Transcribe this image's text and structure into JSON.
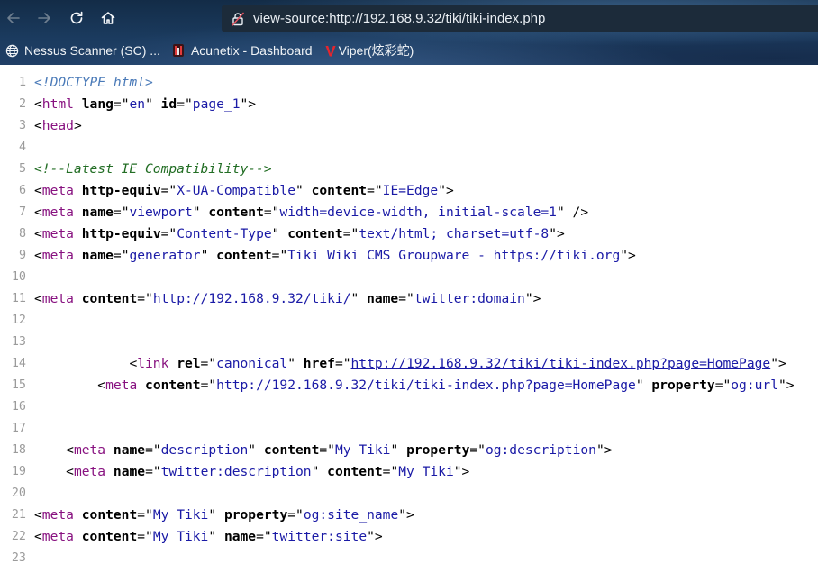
{
  "browser": {
    "nav": {
      "back_icon": "arrow-left-icon",
      "forward_icon": "arrow-right-icon",
      "reload_icon": "reload-icon",
      "home_icon": "home-icon"
    },
    "url": "view-source:http://192.168.9.32/tiki/tiki-index.php",
    "url_icon": "not-secure-icon",
    "bookmarks": [
      {
        "label": "Nessus Scanner (SC) ...",
        "icon": "globe-icon"
      },
      {
        "label": "Acunetix - Dashboard",
        "icon": "acunetix-icon"
      },
      {
        "label": "Viper(炫彩蛇)",
        "icon": "viper-v-icon"
      }
    ],
    "colors": {
      "chrome_bg": "#17324f",
      "tag": "#881280",
      "attr_value": "#1a1aa6",
      "comment": "#236e25",
      "line_number": "#9b9b9b"
    }
  },
  "source": {
    "lines": [
      {
        "n": "1",
        "indent": "",
        "parts": [
          {
            "t": "<!DOCTYPE html>",
            "k": "doc"
          }
        ]
      },
      {
        "n": "2",
        "indent": "",
        "parts": [
          {
            "t": "<",
            "k": "punc"
          },
          {
            "t": "html",
            "k": "tag"
          },
          {
            "t": " ",
            "k": "punc"
          },
          {
            "t": "lang",
            "k": "attr"
          },
          {
            "t": "=\"",
            "k": "punc"
          },
          {
            "t": "en",
            "k": "val"
          },
          {
            "t": "\" ",
            "k": "punc"
          },
          {
            "t": "id",
            "k": "attr"
          },
          {
            "t": "=\"",
            "k": "punc"
          },
          {
            "t": "page_1",
            "k": "val"
          },
          {
            "t": "\">",
            "k": "punc"
          }
        ]
      },
      {
        "n": "3",
        "indent": "",
        "parts": [
          {
            "t": "<",
            "k": "punc"
          },
          {
            "t": "head",
            "k": "tag"
          },
          {
            "t": ">",
            "k": "punc"
          }
        ]
      },
      {
        "n": "4",
        "indent": "",
        "parts": []
      },
      {
        "n": "5",
        "indent": "",
        "parts": [
          {
            "t": "<!--Latest IE Compatibility-->",
            "k": "com"
          }
        ]
      },
      {
        "n": "6",
        "indent": "",
        "parts": [
          {
            "t": "<",
            "k": "punc"
          },
          {
            "t": "meta",
            "k": "tag"
          },
          {
            "t": " ",
            "k": "punc"
          },
          {
            "t": "http-equiv",
            "k": "attr"
          },
          {
            "t": "=\"",
            "k": "punc"
          },
          {
            "t": "X-UA-Compatible",
            "k": "val"
          },
          {
            "t": "\" ",
            "k": "punc"
          },
          {
            "t": "content",
            "k": "attr"
          },
          {
            "t": "=\"",
            "k": "punc"
          },
          {
            "t": "IE=Edge",
            "k": "val"
          },
          {
            "t": "\">",
            "k": "punc"
          }
        ]
      },
      {
        "n": "7",
        "indent": "",
        "parts": [
          {
            "t": "<",
            "k": "punc"
          },
          {
            "t": "meta",
            "k": "tag"
          },
          {
            "t": " ",
            "k": "punc"
          },
          {
            "t": "name",
            "k": "attr"
          },
          {
            "t": "=\"",
            "k": "punc"
          },
          {
            "t": "viewport",
            "k": "val"
          },
          {
            "t": "\" ",
            "k": "punc"
          },
          {
            "t": "content",
            "k": "attr"
          },
          {
            "t": "=\"",
            "k": "punc"
          },
          {
            "t": "width=device-width, initial-scale=1",
            "k": "val"
          },
          {
            "t": "\" />",
            "k": "punc"
          }
        ]
      },
      {
        "n": "8",
        "indent": "",
        "parts": [
          {
            "t": "<",
            "k": "punc"
          },
          {
            "t": "meta",
            "k": "tag"
          },
          {
            "t": " ",
            "k": "punc"
          },
          {
            "t": "http-equiv",
            "k": "attr"
          },
          {
            "t": "=\"",
            "k": "punc"
          },
          {
            "t": "Content-Type",
            "k": "val"
          },
          {
            "t": "\" ",
            "k": "punc"
          },
          {
            "t": "content",
            "k": "attr"
          },
          {
            "t": "=\"",
            "k": "punc"
          },
          {
            "t": "text/html; charset=utf-8",
            "k": "val"
          },
          {
            "t": "\">",
            "k": "punc"
          }
        ]
      },
      {
        "n": "9",
        "indent": "",
        "parts": [
          {
            "t": "<",
            "k": "punc"
          },
          {
            "t": "meta",
            "k": "tag"
          },
          {
            "t": " ",
            "k": "punc"
          },
          {
            "t": "name",
            "k": "attr"
          },
          {
            "t": "=\"",
            "k": "punc"
          },
          {
            "t": "generator",
            "k": "val"
          },
          {
            "t": "\" ",
            "k": "punc"
          },
          {
            "t": "content",
            "k": "attr"
          },
          {
            "t": "=\"",
            "k": "punc"
          },
          {
            "t": "Tiki Wiki CMS Groupware - https://tiki.org",
            "k": "val"
          },
          {
            "t": "\">",
            "k": "punc"
          }
        ]
      },
      {
        "n": "10",
        "indent": "",
        "parts": []
      },
      {
        "n": "11",
        "indent": "",
        "parts": [
          {
            "t": "<",
            "k": "punc"
          },
          {
            "t": "meta",
            "k": "tag"
          },
          {
            "t": " ",
            "k": "punc"
          },
          {
            "t": "content",
            "k": "attr"
          },
          {
            "t": "=\"",
            "k": "punc"
          },
          {
            "t": "http://192.168.9.32/tiki/",
            "k": "val"
          },
          {
            "t": "\" ",
            "k": "punc"
          },
          {
            "t": "name",
            "k": "attr"
          },
          {
            "t": "=\"",
            "k": "punc"
          },
          {
            "t": "twitter:domain",
            "k": "val"
          },
          {
            "t": "\">",
            "k": "punc"
          }
        ]
      },
      {
        "n": "12",
        "indent": "",
        "parts": []
      },
      {
        "n": "13",
        "indent": "",
        "parts": []
      },
      {
        "n": "14",
        "indent": "            ",
        "parts": [
          {
            "t": "<",
            "k": "punc"
          },
          {
            "t": "link",
            "k": "tag"
          },
          {
            "t": " ",
            "k": "punc"
          },
          {
            "t": "rel",
            "k": "attr"
          },
          {
            "t": "=\"",
            "k": "punc"
          },
          {
            "t": "canonical",
            "k": "val"
          },
          {
            "t": "\" ",
            "k": "punc"
          },
          {
            "t": "href",
            "k": "attr"
          },
          {
            "t": "=\"",
            "k": "punc"
          },
          {
            "t": "http://192.168.9.32/tiki/tiki-index.php?page=HomePage",
            "k": "lnk"
          },
          {
            "t": "\">",
            "k": "punc"
          }
        ]
      },
      {
        "n": "15",
        "indent": "        ",
        "parts": [
          {
            "t": "<",
            "k": "punc"
          },
          {
            "t": "meta",
            "k": "tag"
          },
          {
            "t": " ",
            "k": "punc"
          },
          {
            "t": "content",
            "k": "attr"
          },
          {
            "t": "=\"",
            "k": "punc"
          },
          {
            "t": "http://192.168.9.32/tiki/tiki-index.php?page=HomePage",
            "k": "val"
          },
          {
            "t": "\" ",
            "k": "punc"
          },
          {
            "t": "property",
            "k": "attr"
          },
          {
            "t": "=\"",
            "k": "punc"
          },
          {
            "t": "og:url",
            "k": "val"
          },
          {
            "t": "\">",
            "k": "punc"
          }
        ]
      },
      {
        "n": "16",
        "indent": "",
        "parts": []
      },
      {
        "n": "17",
        "indent": "",
        "parts": []
      },
      {
        "n": "18",
        "indent": "    ",
        "parts": [
          {
            "t": "<",
            "k": "punc"
          },
          {
            "t": "meta",
            "k": "tag"
          },
          {
            "t": " ",
            "k": "punc"
          },
          {
            "t": "name",
            "k": "attr"
          },
          {
            "t": "=\"",
            "k": "punc"
          },
          {
            "t": "description",
            "k": "val"
          },
          {
            "t": "\" ",
            "k": "punc"
          },
          {
            "t": "content",
            "k": "attr"
          },
          {
            "t": "=\"",
            "k": "punc"
          },
          {
            "t": "My Tiki",
            "k": "val"
          },
          {
            "t": "\" ",
            "k": "punc"
          },
          {
            "t": "property",
            "k": "attr"
          },
          {
            "t": "=\"",
            "k": "punc"
          },
          {
            "t": "og:description",
            "k": "val"
          },
          {
            "t": "\">",
            "k": "punc"
          }
        ]
      },
      {
        "n": "19",
        "indent": "    ",
        "parts": [
          {
            "t": "<",
            "k": "punc"
          },
          {
            "t": "meta",
            "k": "tag"
          },
          {
            "t": " ",
            "k": "punc"
          },
          {
            "t": "name",
            "k": "attr"
          },
          {
            "t": "=\"",
            "k": "punc"
          },
          {
            "t": "twitter:description",
            "k": "val"
          },
          {
            "t": "\" ",
            "k": "punc"
          },
          {
            "t": "content",
            "k": "attr"
          },
          {
            "t": "=\"",
            "k": "punc"
          },
          {
            "t": "My Tiki",
            "k": "val"
          },
          {
            "t": "\">",
            "k": "punc"
          }
        ]
      },
      {
        "n": "20",
        "indent": "",
        "parts": []
      },
      {
        "n": "21",
        "indent": "",
        "parts": [
          {
            "t": "<",
            "k": "punc"
          },
          {
            "t": "meta",
            "k": "tag"
          },
          {
            "t": " ",
            "k": "punc"
          },
          {
            "t": "content",
            "k": "attr"
          },
          {
            "t": "=\"",
            "k": "punc"
          },
          {
            "t": "My Tiki",
            "k": "val"
          },
          {
            "t": "\" ",
            "k": "punc"
          },
          {
            "t": "property",
            "k": "attr"
          },
          {
            "t": "=\"",
            "k": "punc"
          },
          {
            "t": "og:site_name",
            "k": "val"
          },
          {
            "t": "\">",
            "k": "punc"
          }
        ]
      },
      {
        "n": "22",
        "indent": "",
        "parts": [
          {
            "t": "<",
            "k": "punc"
          },
          {
            "t": "meta",
            "k": "tag"
          },
          {
            "t": " ",
            "k": "punc"
          },
          {
            "t": "content",
            "k": "attr"
          },
          {
            "t": "=\"",
            "k": "punc"
          },
          {
            "t": "My Tiki",
            "k": "val"
          },
          {
            "t": "\" ",
            "k": "punc"
          },
          {
            "t": "name",
            "k": "attr"
          },
          {
            "t": "=\"",
            "k": "punc"
          },
          {
            "t": "twitter:site",
            "k": "val"
          },
          {
            "t": "\">",
            "k": "punc"
          }
        ]
      },
      {
        "n": "23",
        "indent": "",
        "parts": []
      }
    ]
  }
}
